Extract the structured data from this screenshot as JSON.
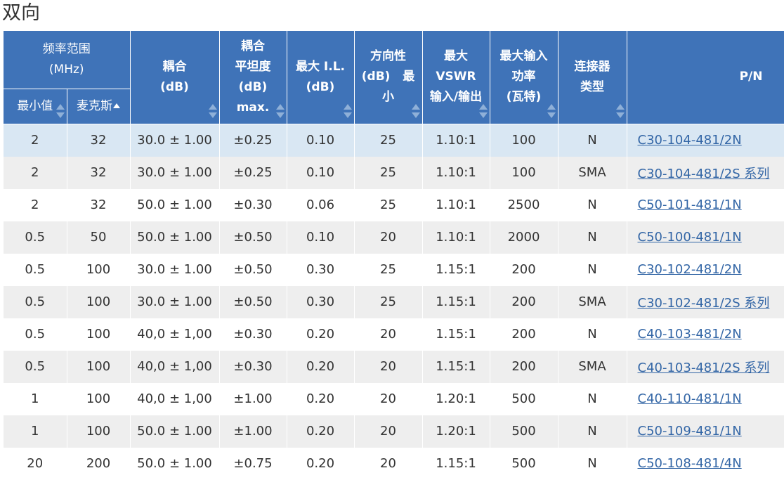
{
  "page": {
    "title": "双向"
  },
  "header": {
    "freq_group": [
      "频率范围",
      "(MHz)"
    ],
    "freq_min": "最小值",
    "freq_max": "麦克斯",
    "coupling": [
      "耦合",
      "(dB)"
    ],
    "flatness": [
      "耦合",
      "平坦度",
      "(dB)",
      "max."
    ],
    "il": [
      "最大 I.L.",
      "(dB)"
    ],
    "directivity": [
      "方向性",
      "(dB)   最",
      "小"
    ],
    "vswr": [
      "最大",
      "VSWR",
      "输入/输出"
    ],
    "power": [
      "最大输入",
      "功率",
      "(瓦特)"
    ],
    "connector": [
      "连接器",
      "类型"
    ],
    "pn": "P/N"
  },
  "rows": [
    {
      "min": "2",
      "max": "32",
      "coupling": "30.0 ± 1.00",
      "flatness": "±0.25",
      "il": "0.10",
      "dir": "25",
      "vswr": "1.10:1",
      "power": "100",
      "conn": "N",
      "pn": "C30-104-481/2N"
    },
    {
      "min": "2",
      "max": "32",
      "coupling": "30.0 ± 1.00",
      "flatness": "±0.25",
      "il": "0.10",
      "dir": "25",
      "vswr": "1.10:1",
      "power": "100",
      "conn": "SMA",
      "pn": "C30-104-481/2S 系列"
    },
    {
      "min": "2",
      "max": "32",
      "coupling": "50.0 ± 1.00",
      "flatness": "±0.30",
      "il": "0.06",
      "dir": "25",
      "vswr": "1.10:1",
      "power": "2500",
      "conn": "N",
      "pn": "C50-101-481/1N"
    },
    {
      "min": "0.5",
      "max": "50",
      "coupling": "50.0 ± 1.00",
      "flatness": "±0.50",
      "il": "0.10",
      "dir": "20",
      "vswr": "1.10:1",
      "power": "2000",
      "conn": "N",
      "pn": "C50-100-481/1N"
    },
    {
      "min": "0.5",
      "max": "100",
      "coupling": "30.0 ± 1.00",
      "flatness": "±0.50",
      "il": "0.30",
      "dir": "25",
      "vswr": "1.15:1",
      "power": "200",
      "conn": "N",
      "pn": "C30-102-481/2N"
    },
    {
      "min": "0.5",
      "max": "100",
      "coupling": "30.0 ± 1.00",
      "flatness": "±0.50",
      "il": "0.30",
      "dir": "25",
      "vswr": "1.15:1",
      "power": "200",
      "conn": "SMA",
      "pn": "C30-102-481/2S 系列"
    },
    {
      "min": "0.5",
      "max": "100",
      "coupling": "40,0 ± 1,00",
      "flatness": "±0.30",
      "il": "0.20",
      "dir": "20",
      "vswr": "1.15:1",
      "power": "200",
      "conn": "N",
      "pn": "C40-103-481/2N"
    },
    {
      "min": "0.5",
      "max": "100",
      "coupling": "40,0 ± 1,00",
      "flatness": "±0.30",
      "il": "0.20",
      "dir": "20",
      "vswr": "1.15:1",
      "power": "200",
      "conn": "SMA",
      "pn": "C40-103-481/2S 系列"
    },
    {
      "min": "1",
      "max": "100",
      "coupling": "40,0 ± 1,00",
      "flatness": "±1.00",
      "il": "0.20",
      "dir": "20",
      "vswr": "1.20:1",
      "power": "500",
      "conn": "N",
      "pn": "C40-110-481/1N"
    },
    {
      "min": "1",
      "max": "100",
      "coupling": "50.0 ± 1.00",
      "flatness": "±1.00",
      "il": "0.20",
      "dir": "20",
      "vswr": "1.20:1",
      "power": "500",
      "conn": "N",
      "pn": "C50-109-481/1N"
    },
    {
      "min": "20",
      "max": "200",
      "coupling": "50.0 ± 1.00",
      "flatness": "±0.75",
      "il": "0.20",
      "dir": "20",
      "vswr": "1.15:1",
      "power": "500",
      "conn": "N",
      "pn": "C50-108-481/4N"
    }
  ]
}
